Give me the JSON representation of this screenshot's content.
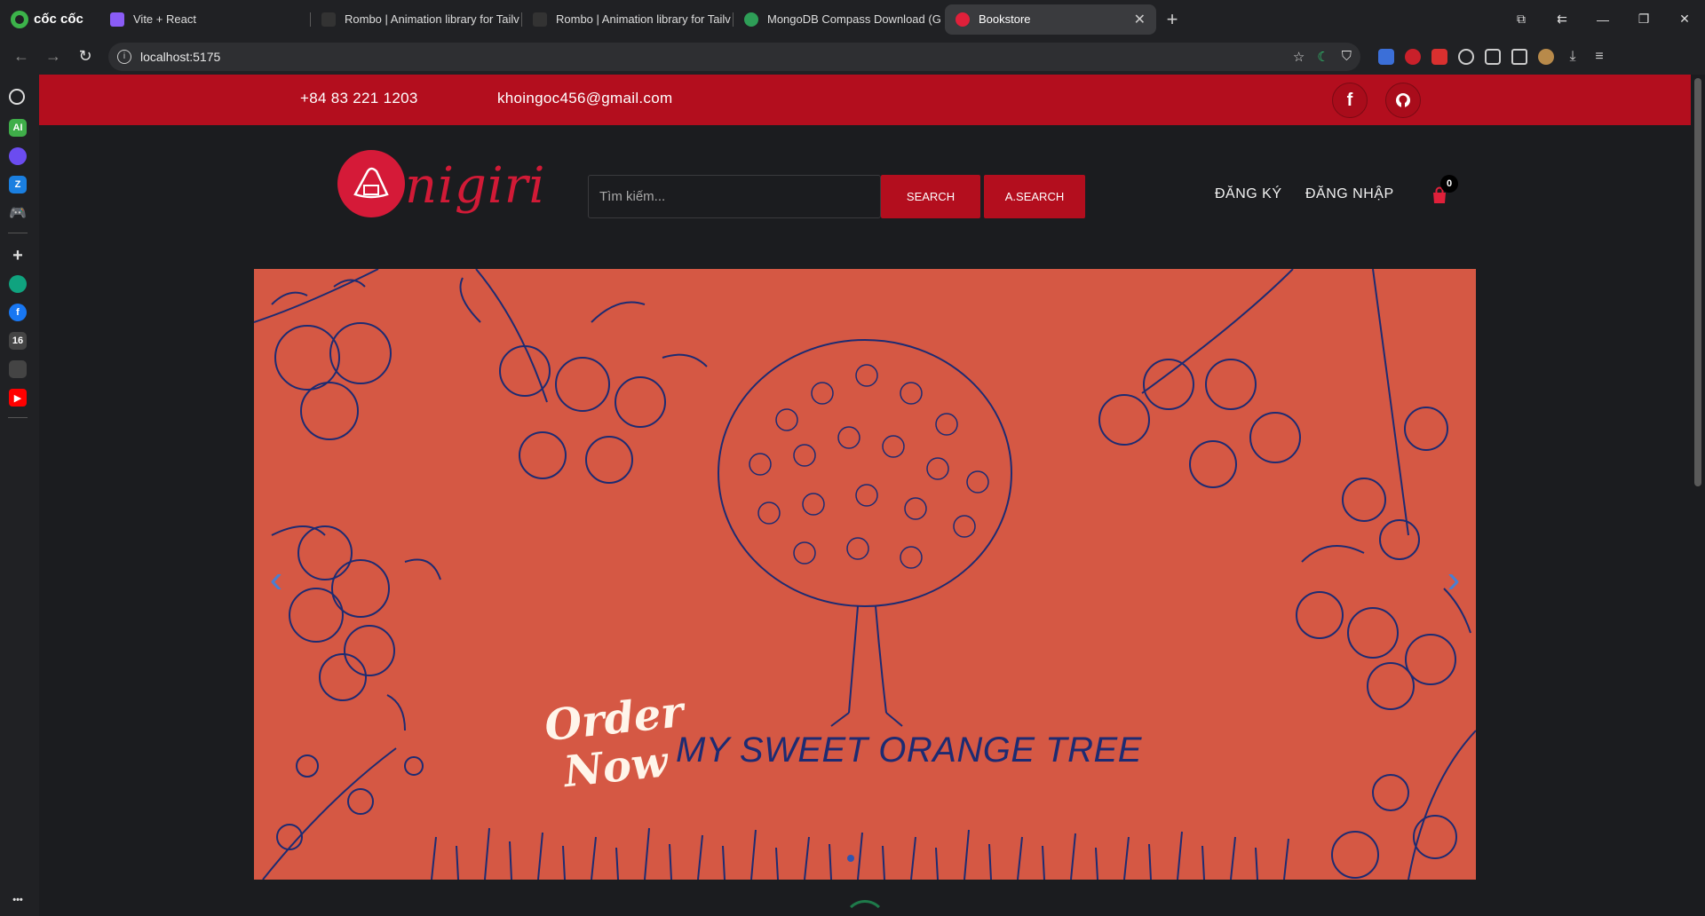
{
  "browser": {
    "brand": "cốc cốc",
    "tabs": [
      {
        "title": "Vite + React",
        "favicon_color": "#8a5cf6"
      },
      {
        "title": "Rombo | Animation library for Tailv",
        "favicon_color": "#333333"
      },
      {
        "title": "Rombo | Animation library for Tailv",
        "favicon_color": "#333333"
      },
      {
        "title": "MongoDB Compass Download (G",
        "favicon_color": "#2e9e57"
      },
      {
        "title": "Bookstore",
        "favicon_color": "#e0203a",
        "active": true
      }
    ],
    "new_tab": "+",
    "url": "localhost:5175"
  },
  "sidebar": {
    "icons": [
      "history-icon",
      "ai-icon",
      "messenger-icon",
      "zalo-icon",
      "game-icon",
      "add-icon",
      "chatgpt-icon",
      "facebook-icon",
      "tiktok-icon",
      "app-icon",
      "youtube-icon",
      "more-icon"
    ]
  },
  "topbar": {
    "phone": "+84 83 221 1203",
    "email": "khoingoc456@gmail.com",
    "social": [
      "facebook-icon",
      "github-icon"
    ]
  },
  "header": {
    "logo_text": "nigiri",
    "search_placeholder": "Tìm kiếm...",
    "search_button": "SEARCH",
    "advanced_search_button": "A.SEARCH",
    "register": "ĐĂNG KÝ",
    "login": "ĐĂNG NHẬP",
    "cart_count": "0"
  },
  "carousel": {
    "order_line1": "Order",
    "order_line2": "Now",
    "title": "MY SWEET ORANGE TREE",
    "prev": "‹",
    "next": "›",
    "accent_color": "#d55844"
  }
}
